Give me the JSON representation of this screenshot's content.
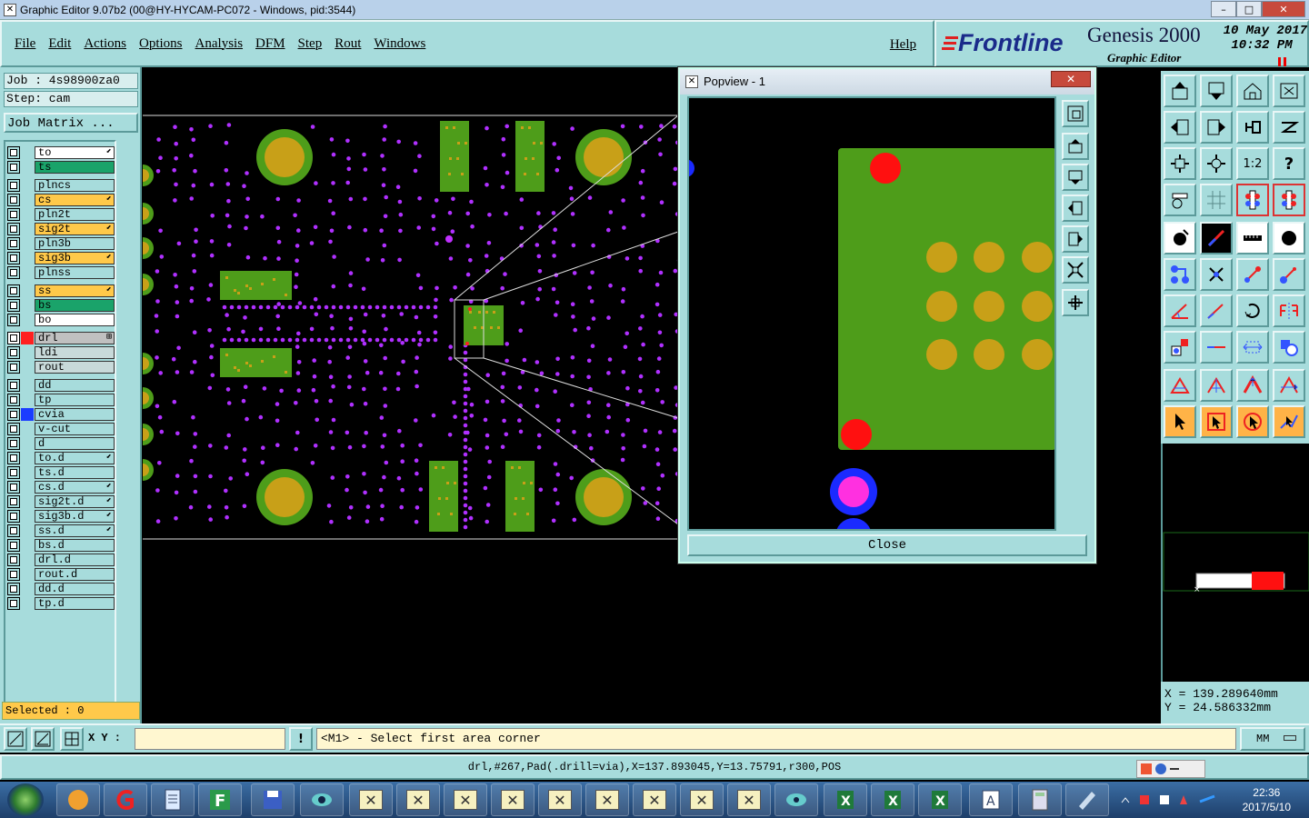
{
  "window": {
    "title": "Graphic Editor 9.07b2 (00@HY-HYCAM-PC072 - Windows, pid:3544)",
    "controls": [
      "–",
      "□",
      "✕"
    ]
  },
  "menu": {
    "items": [
      "File",
      "Edit",
      "Actions",
      "Options",
      "Analysis",
      "DFM",
      "Step",
      "Rout",
      "Windows"
    ],
    "help": "Help"
  },
  "brand": {
    "logo": "Frontline",
    "product": "Genesis 2000",
    "subtitle": "Graphic Editor",
    "date": "10 May 2017",
    "time": "10:32 PM"
  },
  "job": {
    "job_label": "Job : 4s98900za0",
    "step_label": "Step: cam",
    "matrix_button": "Job Matrix ..."
  },
  "layers": [
    {
      "name": "to",
      "color": "#ffffff",
      "arrow": true,
      "swatch": ""
    },
    {
      "name": "ts",
      "color": "#1aa36a",
      "arrow": false,
      "swatch": ""
    },
    {
      "name": "plncs",
      "color": "#a7dcdc",
      "arrow": false,
      "swatch": ""
    },
    {
      "name": "cs",
      "color": "#ffc94a",
      "arrow": true,
      "swatch": ""
    },
    {
      "name": "pln2t",
      "color": "#a7dcdc",
      "arrow": false,
      "swatch": ""
    },
    {
      "name": "sig2t",
      "color": "#ffc94a",
      "arrow": true,
      "swatch": ""
    },
    {
      "name": "pln3b",
      "color": "#a7dcdc",
      "arrow": false,
      "swatch": ""
    },
    {
      "name": "sig3b",
      "color": "#ffc94a",
      "arrow": true,
      "swatch": ""
    },
    {
      "name": "plnss",
      "color": "#a7dcdc",
      "arrow": false,
      "swatch": ""
    },
    {
      "name": "ss",
      "color": "#ffc94a",
      "arrow": true,
      "swatch": ""
    },
    {
      "name": "bs",
      "color": "#1aa36a",
      "arrow": false,
      "swatch": ""
    },
    {
      "name": "bo",
      "color": "#ffffff",
      "arrow": false,
      "swatch": ""
    },
    {
      "name": "drl",
      "color": "#c0c0c0",
      "arrow": false,
      "swatch": "#ff2020",
      "mark": "⊞"
    },
    {
      "name": "ldi",
      "color": "#c8dada",
      "arrow": false,
      "swatch": ""
    },
    {
      "name": "rout",
      "color": "#c8dada",
      "arrow": false,
      "swatch": ""
    },
    {
      "name": "dd",
      "color": "#a7dcdc",
      "arrow": false,
      "swatch": ""
    },
    {
      "name": "tp",
      "color": "#a7dcdc",
      "arrow": false,
      "swatch": ""
    },
    {
      "name": "cvia",
      "color": "#a7dcdc",
      "arrow": false,
      "swatch": "#1a3cff"
    },
    {
      "name": "v-cut",
      "color": "#a7dcdc",
      "arrow": false,
      "swatch": ""
    },
    {
      "name": "d",
      "color": "#a7dcdc",
      "arrow": false,
      "swatch": ""
    },
    {
      "name": "to.d",
      "color": "#a7dcdc",
      "arrow": true,
      "swatch": ""
    },
    {
      "name": "ts.d",
      "color": "#a7dcdc",
      "arrow": false,
      "swatch": ""
    },
    {
      "name": "cs.d",
      "color": "#a7dcdc",
      "arrow": true,
      "swatch": ""
    },
    {
      "name": "sig2t.d",
      "color": "#a7dcdc",
      "arrow": true,
      "swatch": ""
    },
    {
      "name": "sig3b.d",
      "color": "#a7dcdc",
      "arrow": true,
      "swatch": ""
    },
    {
      "name": "ss.d",
      "color": "#a7dcdc",
      "arrow": true,
      "swatch": ""
    },
    {
      "name": "bs.d",
      "color": "#a7dcdc",
      "arrow": false,
      "swatch": ""
    },
    {
      "name": "drl.d",
      "color": "#a7dcdc",
      "arrow": false,
      "swatch": ""
    },
    {
      "name": "rout.d",
      "color": "#a7dcdc",
      "arrow": false,
      "swatch": ""
    },
    {
      "name": "dd.d",
      "color": "#a7dcdc",
      "arrow": false,
      "swatch": ""
    },
    {
      "name": "tp.d",
      "color": "#a7dcdc",
      "arrow": false,
      "swatch": ""
    }
  ],
  "selected_label": "Selected : 0",
  "popview": {
    "title": "Popview - 1",
    "close_label": "Close",
    "close_x": "✕"
  },
  "toolbox": {
    "scale_label": "1:2",
    "help_label": "?"
  },
  "coords": {
    "x": "X = 139.289640mm",
    "y": "Y = 24.586332mm"
  },
  "command": {
    "xy_label": "X Y :",
    "xy_value": "",
    "alert": "!",
    "message": "<M1> - Select first area corner",
    "units": "MM"
  },
  "status_text": "drl,#267,Pad(.drill=via),X=137.893045,Y=13.75791,r300,POS",
  "taskbar": {
    "time": "22:36",
    "date": "2017/5/10"
  }
}
